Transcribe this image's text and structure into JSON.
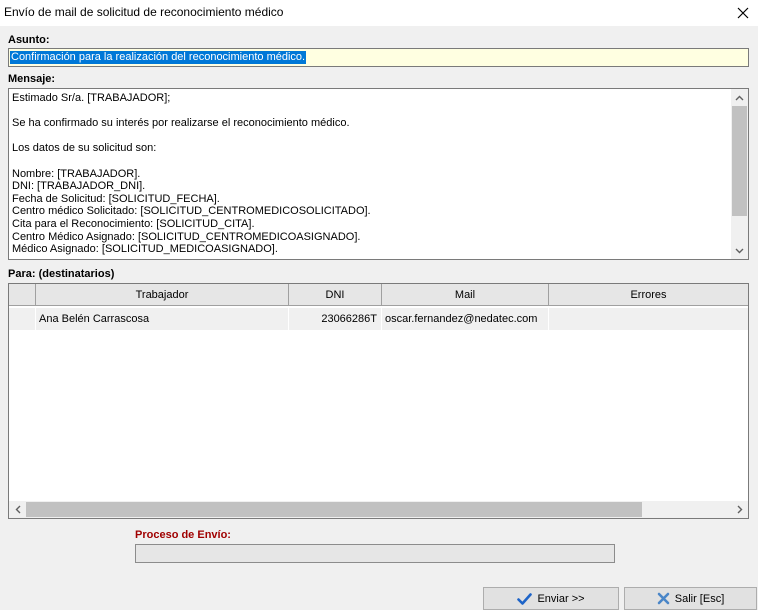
{
  "window": {
    "title": "Envío de mail de solicitud de reconocimiento médico"
  },
  "subject": {
    "label": "Asunto:",
    "value": "Confirmación para la realización del reconocimiento médico."
  },
  "message": {
    "label": "Mensaje:",
    "body": "Estimado Sr/a. [TRABAJADOR];\n\nSe ha confirmado su interés por realizarse el reconocimiento médico.\n\nLos datos de su solicitud son:\n\nNombre: [TRABAJADOR].\nDNI: [TRABAJADOR_DNI].\nFecha de Solicitud: [SOLICITUD_FECHA].\nCentro médico Solicitado: [SOLICITUD_CENTROMEDICOSOLICITADO].\nCita para el Reconocimiento: [SOLICITUD_CITA].\nCentro Médico Asignado: [SOLICITUD_CENTROMEDICOASIGNADO].\nMédico Asignado: [SOLICITUD_MEDICOASIGNADO]."
  },
  "recipients": {
    "label": "Para: (destinatarios)",
    "columns": [
      "Trabajador",
      "DNI",
      "Mail",
      "Errores"
    ],
    "rows": [
      {
        "trabajador": "Ana Belén Carrascosa",
        "dni": "23066286T",
        "mail": "oscar.fernandez@nedatec.com",
        "errores": ""
      }
    ]
  },
  "process": {
    "label": "Proceso de Envío:",
    "progress": 0
  },
  "buttons": {
    "send_label": "Enviar >>",
    "exit_label": "Salir [Esc]"
  },
  "colors": {
    "selection": "#0078d7",
    "subject_bg": "#ffffe1",
    "process_label": "#a00000",
    "send_check": "#1e64c8",
    "exit_x": "#4a86c8"
  }
}
